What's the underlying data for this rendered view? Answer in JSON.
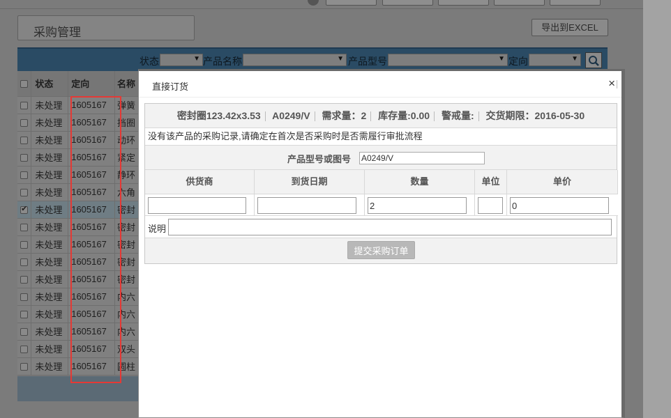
{
  "page": {
    "tab_title": "采购管理",
    "export_label": "导出到EXCEL"
  },
  "filters": {
    "status_label": "状态",
    "product_name_label": "产品名称",
    "product_model_label": "产品型号",
    "direction_label": "定向",
    "arrow": "▼"
  },
  "table": {
    "columns": [
      "状态",
      "定向",
      "名称"
    ],
    "rows": [
      {
        "status": "未处理",
        "direction": "1605167",
        "name": "弹簧",
        "checked": false
      },
      {
        "status": "未处理",
        "direction": "1605167",
        "name": "挡圈",
        "checked": false
      },
      {
        "status": "未处理",
        "direction": "1605167",
        "name": "动环",
        "checked": false
      },
      {
        "status": "未处理",
        "direction": "1605167",
        "name": "紧定",
        "checked": false
      },
      {
        "status": "未处理",
        "direction": "1605167",
        "name": "静环",
        "checked": false
      },
      {
        "status": "未处理",
        "direction": "1605167",
        "name": "六角",
        "checked": false
      },
      {
        "status": "未处理",
        "direction": "1605167",
        "name": "密封",
        "checked": true
      },
      {
        "status": "未处理",
        "direction": "1605167",
        "name": "密封",
        "checked": false
      },
      {
        "status": "未处理",
        "direction": "1605167",
        "name": "密封",
        "checked": false
      },
      {
        "status": "未处理",
        "direction": "1605167",
        "name": "密封",
        "checked": false
      },
      {
        "status": "未处理",
        "direction": "1605167",
        "name": "密封",
        "checked": false
      },
      {
        "status": "未处理",
        "direction": "1605167",
        "name": "内六",
        "checked": false
      },
      {
        "status": "未处理",
        "direction": "1605167",
        "name": "内六",
        "checked": false
      },
      {
        "status": "未处理",
        "direction": "1605167",
        "name": "内六",
        "checked": false
      },
      {
        "status": "未处理",
        "direction": "1605167",
        "name": "双头",
        "checked": false
      },
      {
        "status": "未处理",
        "direction": "1605167",
        "name": "圆柱",
        "checked": false
      }
    ]
  },
  "modal": {
    "title": "直接订货",
    "close_icon": "×",
    "info": {
      "product": "密封圈123.42x3.53",
      "model": "A0249/V",
      "demand": "需求量：2",
      "stock": "库存量:0.00",
      "alert": "警戒量:",
      "deadline": "交货期限：2016-05-30"
    },
    "notice": "没有该产品的采购记录,请确定在首次是否采购时是否需履行审批流程",
    "model_field_label": "产品型号或图号",
    "model_field_value": "A0249/V",
    "columns": {
      "supplier": "供货商",
      "arrival_date": "到货日期",
      "quantity": "数量",
      "unit": "单位",
      "unit_price": "单价"
    },
    "values": {
      "supplier": "",
      "arrival_date": "",
      "quantity": "2",
      "unit": "",
      "unit_price": "0"
    },
    "note_label": "说明",
    "note_value": "",
    "submit_label": "提交采购订单"
  }
}
